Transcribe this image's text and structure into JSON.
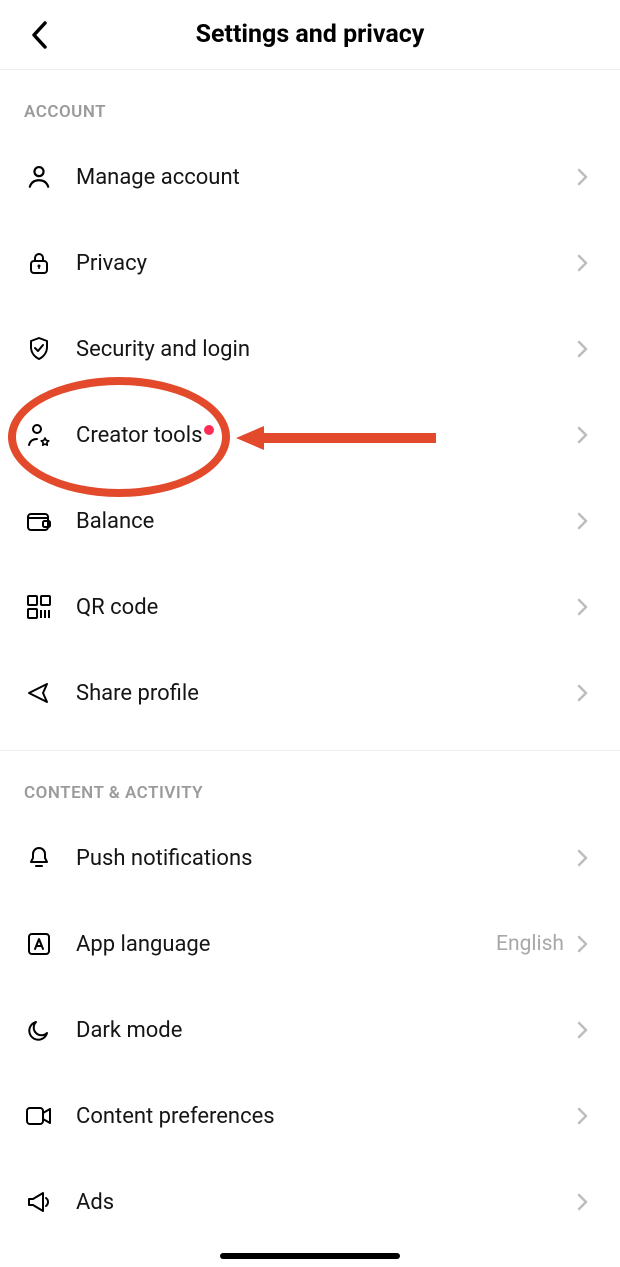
{
  "header": {
    "title": "Settings and privacy"
  },
  "sections": {
    "account": {
      "header": "ACCOUNT",
      "items": {
        "manage_account": "Manage account",
        "privacy": "Privacy",
        "security": "Security and login",
        "creator_tools": "Creator tools",
        "balance": "Balance",
        "qr_code": "QR code",
        "share_profile": "Share profile"
      }
    },
    "content_activity": {
      "header": "CONTENT & ACTIVITY",
      "items": {
        "push_notifications": "Push notifications",
        "app_language": "App language",
        "app_language_value": "English",
        "dark_mode": "Dark mode",
        "content_preferences": "Content preferences",
        "ads": "Ads"
      }
    }
  },
  "annotation": {
    "highlight_color": "#e24a2b"
  }
}
